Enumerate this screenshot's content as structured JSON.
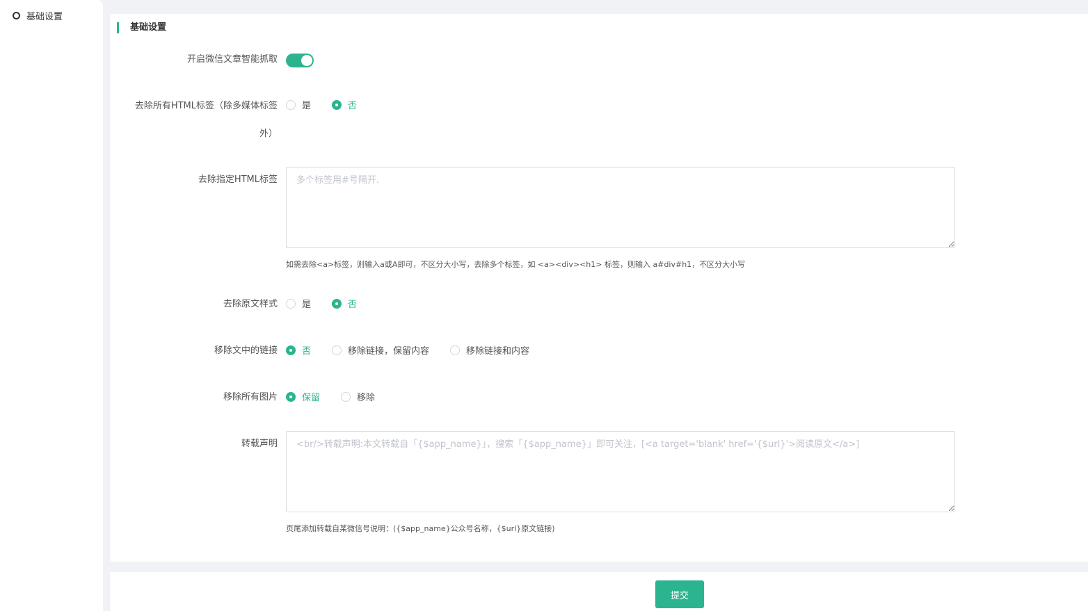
{
  "sidebar": {
    "items": [
      {
        "label": "基础设置",
        "icon": "circle-outline-icon"
      }
    ]
  },
  "section": {
    "title": "基础设置"
  },
  "fields": {
    "smart_fetch": {
      "label": "开启微信文章智能抓取",
      "enabled": true
    },
    "strip_all_html": {
      "label_line1": "去除所有HTML标签（除多媒体标签",
      "label_line2": "外）",
      "options": [
        "是",
        "否"
      ],
      "selected": "否"
    },
    "strip_specific_html": {
      "label": "去除指定HTML标签",
      "placeholder": "多个标签用#号隔开.",
      "value": "",
      "help": "如需去除<a>标签，则输入a或A即可，不区分大小写，去除多个标签，如 <a><div><h1> 标签，则输入 a#div#h1，不区分大小写"
    },
    "strip_original_style": {
      "label": "去除原文样式",
      "options": [
        "是",
        "否"
      ],
      "selected": "否"
    },
    "remove_links": {
      "label": "移除文中的链接",
      "options": [
        "否",
        "移除链接，保留内容",
        "移除链接和内容"
      ],
      "selected": "否"
    },
    "remove_images": {
      "label": "移除所有图片",
      "options": [
        "保留",
        "移除"
      ],
      "selected": "保留"
    },
    "reprint_notice": {
      "label": "转载声明",
      "placeholder": "<br/>转载声明:本文转载自「{$app_name}」，搜索「{$app_name}」即可关注，[<a target='blank' href='{$url}'>阅读原文</a>]",
      "value": "",
      "help": "页尾添加转载自某微信号说明：({$app_name}公众号名称，{$url}原文链接)"
    }
  },
  "footer": {
    "submit_label": "提交"
  },
  "colors": {
    "accent": "#2cb48f",
    "page_bg": "#f0f2f5"
  }
}
